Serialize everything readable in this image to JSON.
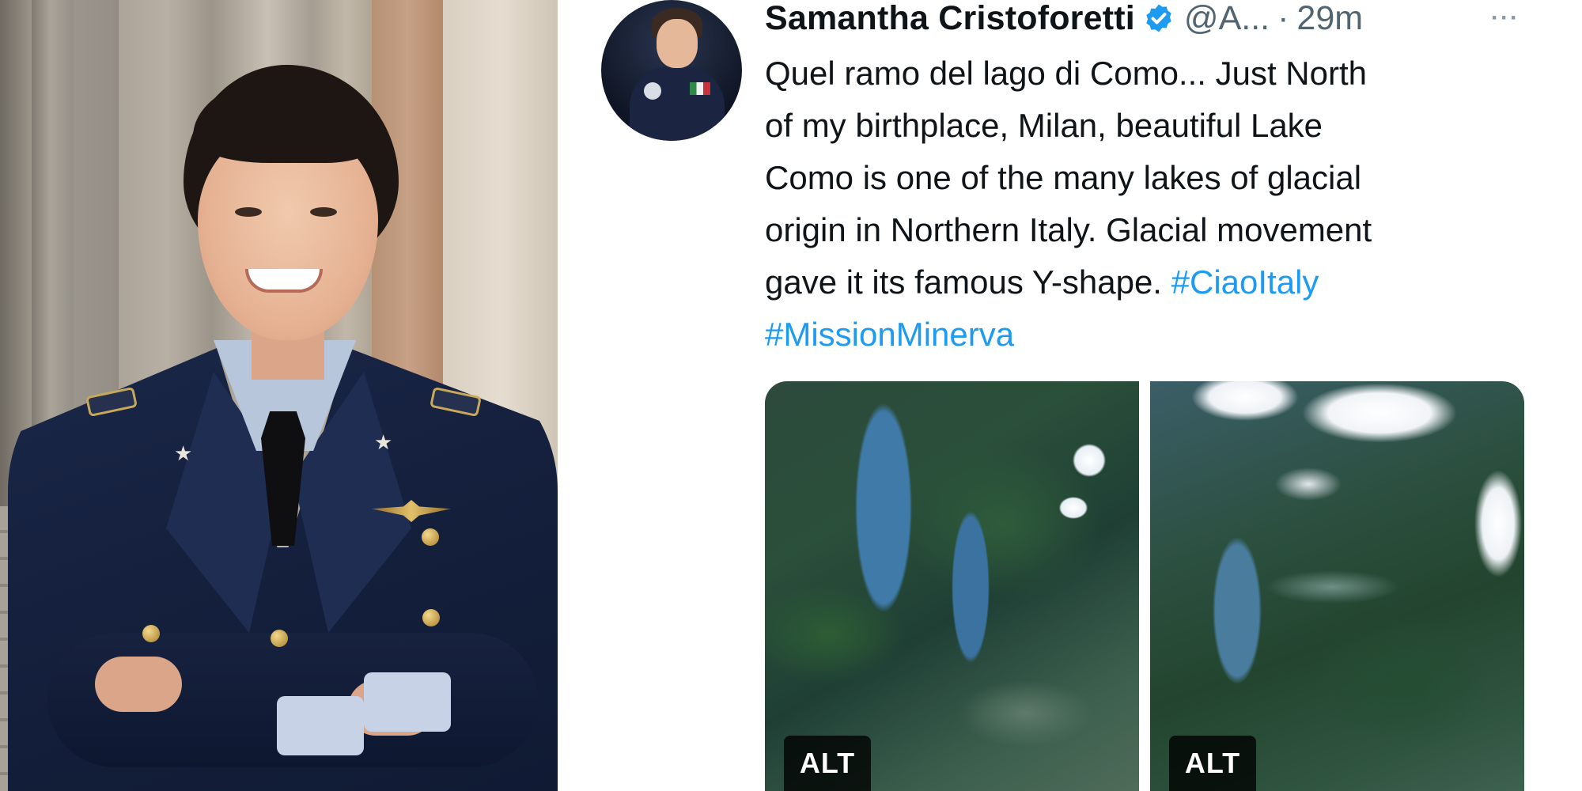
{
  "tweet": {
    "author_name": "Samantha Cristoforetti",
    "handle": "@A...",
    "separator": "·",
    "time_ago": "29m",
    "more_glyph": "···",
    "text_lines": [
      "Quel ramo del lago di Como... Just North",
      "of my birthplace, Milan, beautiful Lake",
      "Como is one of the many lakes of glacial",
      "origin in Northern Italy. Glacial movement"
    ],
    "text_line5_prefix": "gave it its famous Y-shape. ",
    "hashtags": [
      "#CiaoItaly",
      "#MissionMinerva"
    ],
    "media": [
      {
        "alt_badge": "ALT"
      },
      {
        "alt_badge": "ALT"
      }
    ]
  },
  "colors": {
    "hashtag": "#1d9bf0",
    "verified_badge": "#1d9bf0",
    "secondary_text": "#536471"
  },
  "icons": {
    "verified": "verified-badge-icon",
    "more": "more-options-icon"
  }
}
